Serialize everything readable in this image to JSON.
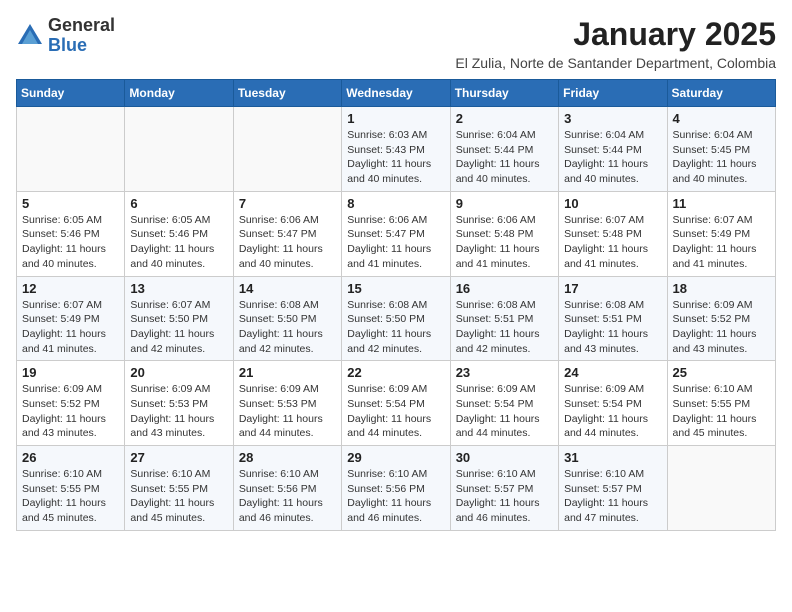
{
  "header": {
    "logo_general": "General",
    "logo_blue": "Blue",
    "month_year": "January 2025",
    "location": "El Zulia, Norte de Santander Department, Colombia"
  },
  "days_of_week": [
    "Sunday",
    "Monday",
    "Tuesday",
    "Wednesday",
    "Thursday",
    "Friday",
    "Saturday"
  ],
  "weeks": [
    [
      {
        "day": "",
        "info": ""
      },
      {
        "day": "",
        "info": ""
      },
      {
        "day": "",
        "info": ""
      },
      {
        "day": "1",
        "info": "Sunrise: 6:03 AM\nSunset: 5:43 PM\nDaylight: 11 hours and 40 minutes."
      },
      {
        "day": "2",
        "info": "Sunrise: 6:04 AM\nSunset: 5:44 PM\nDaylight: 11 hours and 40 minutes."
      },
      {
        "day": "3",
        "info": "Sunrise: 6:04 AM\nSunset: 5:44 PM\nDaylight: 11 hours and 40 minutes."
      },
      {
        "day": "4",
        "info": "Sunrise: 6:04 AM\nSunset: 5:45 PM\nDaylight: 11 hours and 40 minutes."
      }
    ],
    [
      {
        "day": "5",
        "info": "Sunrise: 6:05 AM\nSunset: 5:46 PM\nDaylight: 11 hours and 40 minutes."
      },
      {
        "day": "6",
        "info": "Sunrise: 6:05 AM\nSunset: 5:46 PM\nDaylight: 11 hours and 40 minutes."
      },
      {
        "day": "7",
        "info": "Sunrise: 6:06 AM\nSunset: 5:47 PM\nDaylight: 11 hours and 40 minutes."
      },
      {
        "day": "8",
        "info": "Sunrise: 6:06 AM\nSunset: 5:47 PM\nDaylight: 11 hours and 41 minutes."
      },
      {
        "day": "9",
        "info": "Sunrise: 6:06 AM\nSunset: 5:48 PM\nDaylight: 11 hours and 41 minutes."
      },
      {
        "day": "10",
        "info": "Sunrise: 6:07 AM\nSunset: 5:48 PM\nDaylight: 11 hours and 41 minutes."
      },
      {
        "day": "11",
        "info": "Sunrise: 6:07 AM\nSunset: 5:49 PM\nDaylight: 11 hours and 41 minutes."
      }
    ],
    [
      {
        "day": "12",
        "info": "Sunrise: 6:07 AM\nSunset: 5:49 PM\nDaylight: 11 hours and 41 minutes."
      },
      {
        "day": "13",
        "info": "Sunrise: 6:07 AM\nSunset: 5:50 PM\nDaylight: 11 hours and 42 minutes."
      },
      {
        "day": "14",
        "info": "Sunrise: 6:08 AM\nSunset: 5:50 PM\nDaylight: 11 hours and 42 minutes."
      },
      {
        "day": "15",
        "info": "Sunrise: 6:08 AM\nSunset: 5:50 PM\nDaylight: 11 hours and 42 minutes."
      },
      {
        "day": "16",
        "info": "Sunrise: 6:08 AM\nSunset: 5:51 PM\nDaylight: 11 hours and 42 minutes."
      },
      {
        "day": "17",
        "info": "Sunrise: 6:08 AM\nSunset: 5:51 PM\nDaylight: 11 hours and 43 minutes."
      },
      {
        "day": "18",
        "info": "Sunrise: 6:09 AM\nSunset: 5:52 PM\nDaylight: 11 hours and 43 minutes."
      }
    ],
    [
      {
        "day": "19",
        "info": "Sunrise: 6:09 AM\nSunset: 5:52 PM\nDaylight: 11 hours and 43 minutes."
      },
      {
        "day": "20",
        "info": "Sunrise: 6:09 AM\nSunset: 5:53 PM\nDaylight: 11 hours and 43 minutes."
      },
      {
        "day": "21",
        "info": "Sunrise: 6:09 AM\nSunset: 5:53 PM\nDaylight: 11 hours and 44 minutes."
      },
      {
        "day": "22",
        "info": "Sunrise: 6:09 AM\nSunset: 5:54 PM\nDaylight: 11 hours and 44 minutes."
      },
      {
        "day": "23",
        "info": "Sunrise: 6:09 AM\nSunset: 5:54 PM\nDaylight: 11 hours and 44 minutes."
      },
      {
        "day": "24",
        "info": "Sunrise: 6:09 AM\nSunset: 5:54 PM\nDaylight: 11 hours and 44 minutes."
      },
      {
        "day": "25",
        "info": "Sunrise: 6:10 AM\nSunset: 5:55 PM\nDaylight: 11 hours and 45 minutes."
      }
    ],
    [
      {
        "day": "26",
        "info": "Sunrise: 6:10 AM\nSunset: 5:55 PM\nDaylight: 11 hours and 45 minutes."
      },
      {
        "day": "27",
        "info": "Sunrise: 6:10 AM\nSunset: 5:55 PM\nDaylight: 11 hours and 45 minutes."
      },
      {
        "day": "28",
        "info": "Sunrise: 6:10 AM\nSunset: 5:56 PM\nDaylight: 11 hours and 46 minutes."
      },
      {
        "day": "29",
        "info": "Sunrise: 6:10 AM\nSunset: 5:56 PM\nDaylight: 11 hours and 46 minutes."
      },
      {
        "day": "30",
        "info": "Sunrise: 6:10 AM\nSunset: 5:57 PM\nDaylight: 11 hours and 46 minutes."
      },
      {
        "day": "31",
        "info": "Sunrise: 6:10 AM\nSunset: 5:57 PM\nDaylight: 11 hours and 47 minutes."
      },
      {
        "day": "",
        "info": ""
      }
    ]
  ]
}
